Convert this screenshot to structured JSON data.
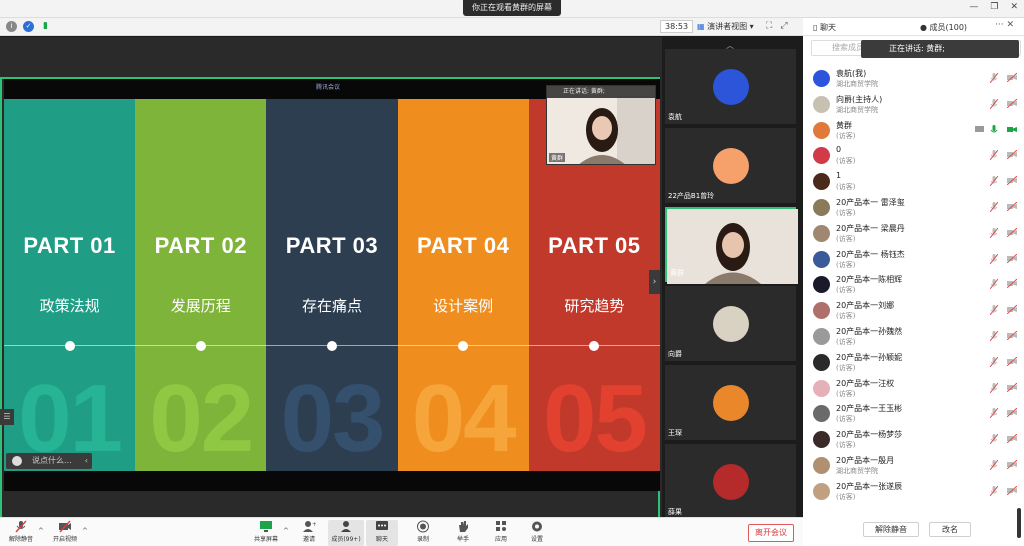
{
  "banner": "你正在观看黄群的屏幕",
  "toolbar": {
    "timer": "38:53",
    "view_label": "演讲者视图",
    "chat_tab": "聊天",
    "members_tab": "成员(100)"
  },
  "slide": {
    "meeting_tag": "腾讯会议",
    "columns": [
      {
        "part": "PART 01",
        "title": "政策法规",
        "num": "01",
        "bg": "#1f9e85",
        "numColor": "#26b494"
      },
      {
        "part": "PART 02",
        "title": "发展历程",
        "num": "02",
        "bg": "#7fb43a",
        "numColor": "#8fc943"
      },
      {
        "part": "PART 03",
        "title": "存在痛点",
        "num": "03",
        "bg": "#2c3e50",
        "numColor": "#34506d"
      },
      {
        "part": "PART 04",
        "title": "设计案例",
        "num": "04",
        "bg": "#ef8e1f",
        "numColor": "#f6a53a"
      },
      {
        "part": "PART 05",
        "title": "研究趋势",
        "num": "05",
        "bg": "#c0392b",
        "numColor": "#e3412f"
      }
    ]
  },
  "pip": {
    "speaking": "正在讲话: 黄群;",
    "name": "黄群"
  },
  "chat_input": "说点什么...",
  "video_tiles": [
    {
      "name": "袁航",
      "avatar": "#2c55d9"
    },
    {
      "name": "22产品B1曾玲",
      "avatar": "#f6a06b"
    },
    {
      "name": "黄群",
      "avatar": "#d8cfc6"
    },
    {
      "name": "向爵",
      "avatar": "#d9d2c3"
    },
    {
      "name": "王琛",
      "avatar": "#e9872a"
    },
    {
      "name": "薛果",
      "avatar": "#b52a2a"
    }
  ],
  "members_panel": {
    "search_placeholder": "搜索成员",
    "speaking": "正在讲话: 黄群;",
    "members": [
      {
        "name": "袁航(我)",
        "sub": "湖北商贸学院",
        "color": "#2c55d9"
      },
      {
        "name": "向爵(主持人)",
        "sub": "湖北商贸学院",
        "color": "#c8c0b0"
      },
      {
        "name": "黄群",
        "sub": "(访客)",
        "color": "#e07a3a"
      },
      {
        "name": "0",
        "sub": "(访客)",
        "color": "#d23a4a"
      },
      {
        "name": "1",
        "sub": "(访客)",
        "color": "#4a2a1a"
      },
      {
        "name": "20产品本一 雷泽玺",
        "sub": "(访客)",
        "color": "#8a7a5a"
      },
      {
        "name": "20产品本一 梁晨丹",
        "sub": "(访客)",
        "color": "#a08870"
      },
      {
        "name": "20产品本一 杨钰杰",
        "sub": "(访客)",
        "color": "#3a5a9a"
      },
      {
        "name": "20产品本一陈相辉",
        "sub": "(访客)",
        "color": "#1a1a2a"
      },
      {
        "name": "20产品本一刘娜",
        "sub": "(访客)",
        "color": "#b0706a"
      },
      {
        "name": "20产品本一孙魏然",
        "sub": "(访客)",
        "color": "#9a9a9a"
      },
      {
        "name": "20产品本一孙颖妮",
        "sub": "(访客)",
        "color": "#2a2a2a"
      },
      {
        "name": "20产品本一汪权",
        "sub": "(访客)",
        "color": "#e6b0b8"
      },
      {
        "name": "20产品本一王玉彬",
        "sub": "(访客)",
        "color": "#6a6a6a"
      },
      {
        "name": "20产品本一杨梦莎",
        "sub": "(访客)",
        "color": "#3a2a2a"
      },
      {
        "name": "20产品本一殷月",
        "sub": "湖北商贸学院",
        "color": "#b09070"
      },
      {
        "name": "20产品本一张遂辰",
        "sub": "(访客)",
        "color": "#c0a080"
      }
    ],
    "unmute_all": "解除静音",
    "rename": "改名"
  },
  "bottom": {
    "unmute": "解除静音",
    "start_video": "开启视频",
    "share_screen": "共享屏幕",
    "invite": "邀请",
    "members": "成员(99+)",
    "chat": "聊天",
    "record": "录制",
    "raise_hand": "举手",
    "apps": "应用",
    "settings": "设置",
    "leave": "离开会议"
  }
}
